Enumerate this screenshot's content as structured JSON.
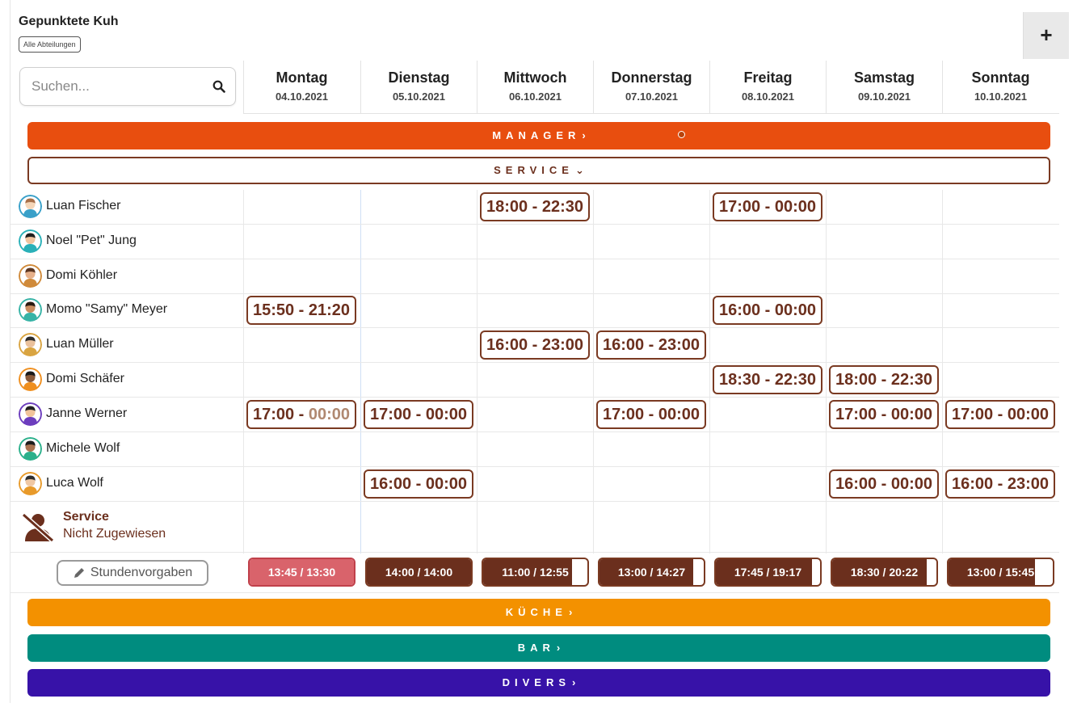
{
  "header": {
    "org_name": "Gepunktete Kuh",
    "department_filter": "Alle Abteilungen",
    "add_label": "+"
  },
  "search": {
    "placeholder": "Suchen..."
  },
  "days": [
    {
      "name": "Montag",
      "date": "04.10.2021"
    },
    {
      "name": "Dienstag",
      "date": "05.10.2021"
    },
    {
      "name": "Mittwoch",
      "date": "06.10.2021"
    },
    {
      "name": "Donnerstag",
      "date": "07.10.2021"
    },
    {
      "name": "Freitag",
      "date": "08.10.2021"
    },
    {
      "name": "Samstag",
      "date": "09.10.2021"
    },
    {
      "name": "Sonntag",
      "date": "10.10.2021"
    }
  ],
  "departments": {
    "manager": {
      "label": "MANAGER",
      "color": "#e84e0f",
      "expanded": false
    },
    "service": {
      "label": "SERVICE",
      "color": "#7a3a22",
      "expanded": true
    },
    "kueche": {
      "label": "KÜCHE",
      "color": "#f39100",
      "expanded": false
    },
    "bar": {
      "label": "BAR",
      "color": "#008c7f",
      "expanded": false
    },
    "divers": {
      "label": "DIVERS",
      "color": "#3712a8",
      "expanded": false
    }
  },
  "employees": [
    {
      "name": "Luan Fischer",
      "avatar_icon": "avatar-luan-fischer-icon",
      "shifts": [
        "",
        "",
        "18:00 - 22:30",
        "",
        "17:00 - 00:00",
        "",
        ""
      ]
    },
    {
      "name": "Noel \"Pet\" Jung",
      "avatar_icon": "avatar-noel-jung-icon",
      "shifts": [
        "",
        "",
        "",
        "",
        "",
        "",
        ""
      ]
    },
    {
      "name": "Domi Köhler",
      "avatar_icon": "avatar-domi-koehler-icon",
      "shifts": [
        "",
        "",
        "",
        "",
        "",
        "",
        ""
      ]
    },
    {
      "name": "Momo \"Samy\" Meyer",
      "avatar_icon": "avatar-momo-meyer-icon",
      "shifts": [
        "15:50 - 21:20",
        "",
        "",
        "",
        "16:00 - 00:00",
        "",
        ""
      ]
    },
    {
      "name": "Luan Müller",
      "avatar_icon": "avatar-luan-mueller-icon",
      "shifts": [
        "",
        "",
        "16:00 - 23:00",
        "16:00 - 23:00",
        "",
        "",
        ""
      ]
    },
    {
      "name": "Domi Schäfer",
      "avatar_icon": "avatar-domi-schaefer-icon",
      "shifts": [
        "",
        "",
        "",
        "",
        "18:30 - 22:30",
        "18:00 - 22:30",
        ""
      ]
    },
    {
      "name": "Janne Werner",
      "avatar_icon": "avatar-janne-werner-icon",
      "shifts": [
        "17:00 - 00:00",
        "17:00 - 00:00",
        "",
        "17:00 - 00:00",
        "",
        "17:00 - 00:00",
        "17:00 - 00:00"
      ]
    },
    {
      "name": "Michele Wolf",
      "avatar_icon": "avatar-michele-wolf-icon",
      "shifts": [
        "",
        "",
        "",
        "",
        "",
        "",
        ""
      ]
    },
    {
      "name": "Luca Wolf",
      "avatar_icon": "avatar-luca-wolf-icon",
      "shifts": [
        "",
        "16:00 - 00:00",
        "",
        "",
        "",
        "16:00 - 00:00",
        "16:00 - 23:00"
      ]
    }
  ],
  "unassigned": {
    "title": "Service",
    "subtitle": "Nicht Zugewiesen"
  },
  "hours_targets": {
    "button_label": "Stundenvorgaben",
    "cells": [
      {
        "text": "13:45 / 13:30",
        "fill_fraction": 1.0,
        "over": true
      },
      {
        "text": "14:00 / 14:00",
        "fill_fraction": 1.0,
        "over": false
      },
      {
        "text": "11:00 / 12:55",
        "fill_fraction": 0.85,
        "over": false
      },
      {
        "text": "13:00 / 14:27",
        "fill_fraction": 0.9,
        "over": false
      },
      {
        "text": "17:45 / 19:17",
        "fill_fraction": 0.92,
        "over": false
      },
      {
        "text": "18:30 / 20:22",
        "fill_fraction": 0.91,
        "over": false
      },
      {
        "text": "13:00 / 15:45",
        "fill_fraction": 0.83,
        "over": false
      }
    ]
  }
}
